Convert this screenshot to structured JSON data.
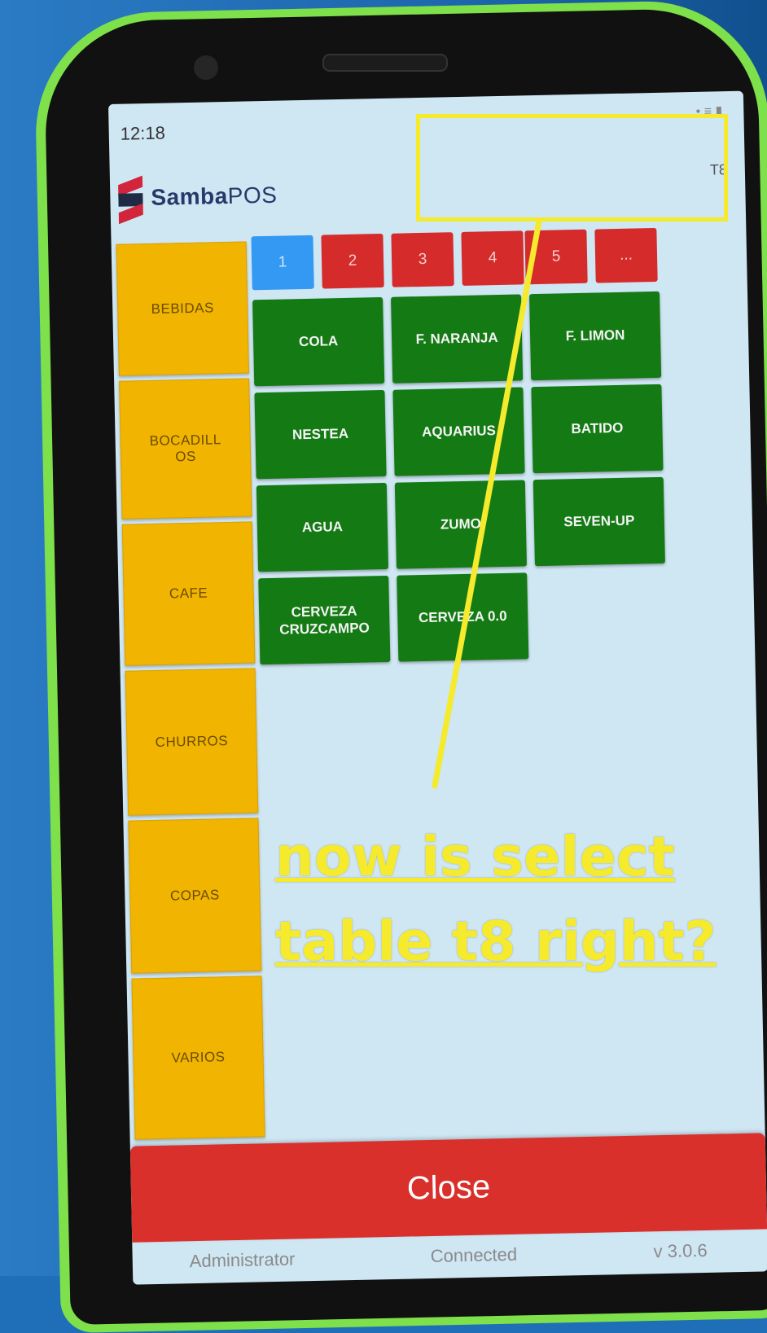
{
  "status_bar": {
    "time": "12:18",
    "icons": "• ≡ ▮"
  },
  "app": {
    "brand_bold": "Samba",
    "brand_light": "POS",
    "selected_table": "T8"
  },
  "categories": [
    {
      "label": "BEBIDAS"
    },
    {
      "label": "BOCADILL\nOS"
    },
    {
      "label": "CAFE"
    },
    {
      "label": "CHURROS"
    },
    {
      "label": "COPAS"
    },
    {
      "label": "VARIOS"
    }
  ],
  "pages": [
    {
      "label": "1",
      "active": true
    },
    {
      "label": "2"
    },
    {
      "label": "3"
    },
    {
      "label": "4"
    },
    {
      "label": "5"
    },
    {
      "label": "..."
    }
  ],
  "menu_items": [
    {
      "label": "COLA"
    },
    {
      "label": "F. NARANJA"
    },
    {
      "label": "F. LIMON"
    },
    {
      "label": "NESTEA"
    },
    {
      "label": "AQUARIUS"
    },
    {
      "label": "BATIDO"
    },
    {
      "label": "AGUA"
    },
    {
      "label": "ZUMO"
    },
    {
      "label": "SEVEN-UP"
    },
    {
      "label": "CERVEZA\nCRUZCAMPO"
    },
    {
      "label": "CERVEZA 0.0"
    }
  ],
  "actions": {
    "close_label": "Close"
  },
  "footer": {
    "user": "Administrator",
    "connection": "Connected",
    "version": "v 3.0.6"
  },
  "annotation": {
    "text": "now is select table t8 right?",
    "color": "#f5ea2b"
  },
  "colors": {
    "category": "#f1b400",
    "item": "#147a14",
    "page_active": "#3399f3",
    "page": "#d52b2b",
    "close": "#d9302c"
  }
}
